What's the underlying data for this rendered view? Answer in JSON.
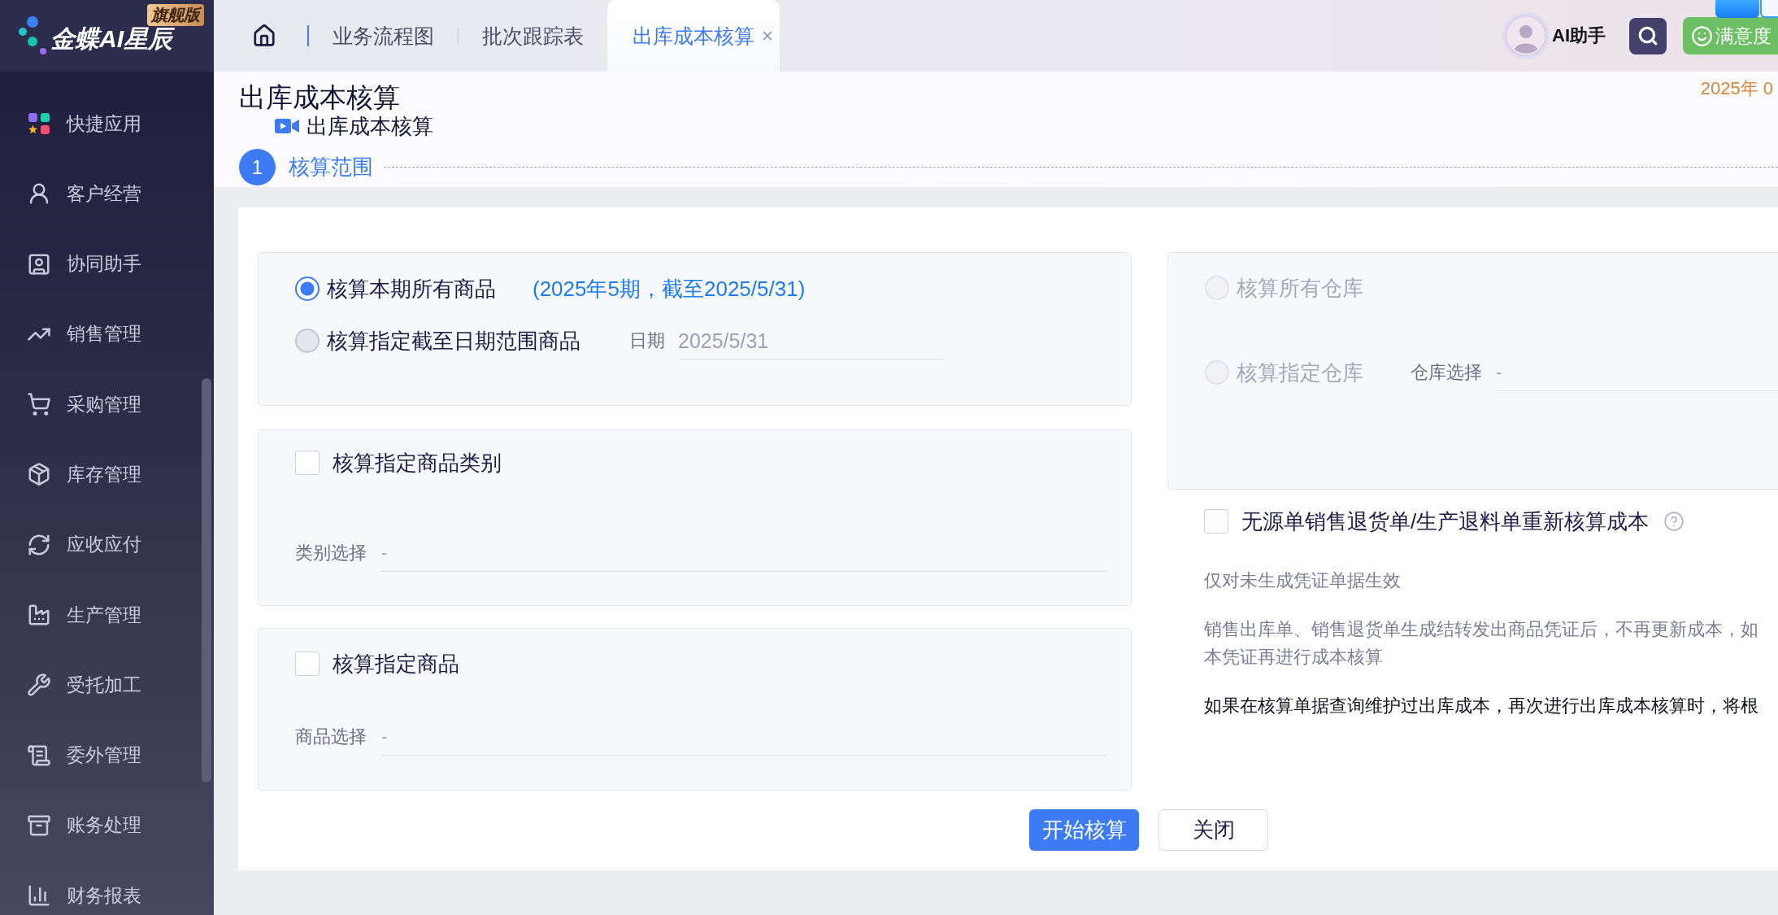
{
  "sidebar": {
    "logo": {
      "text": "金蝶AI星辰",
      "badge": "旗舰版"
    },
    "items": [
      {
        "label": "快捷应用",
        "selected": false
      },
      {
        "label": "客户经营",
        "selected": false
      },
      {
        "label": "协同助手",
        "selected": false
      },
      {
        "label": "销售管理",
        "selected": false
      },
      {
        "label": "采购管理",
        "selected": false
      },
      {
        "label": "库存管理",
        "selected": false
      },
      {
        "label": "应收应付",
        "selected": false
      },
      {
        "label": "生产管理",
        "selected": false
      },
      {
        "label": "受托加工",
        "selected": false
      },
      {
        "label": "委外管理",
        "selected": false
      },
      {
        "label": "账务处理",
        "selected": false
      },
      {
        "label": "财务报表",
        "selected": false
      }
    ]
  },
  "header": {
    "tabs": [
      {
        "label": "业务流程图",
        "selected": false
      },
      {
        "label": "批次跟踪表",
        "selected": false
      },
      {
        "label": "出库成本核算",
        "selected": true
      }
    ],
    "assistant": {
      "label": "AI助手"
    },
    "feedback": {
      "label": "满意度"
    }
  },
  "page": {
    "title": "出库成本核算",
    "date": "2025年 0",
    "subtitle": "出库成本核算",
    "step": {
      "number": "1",
      "label": "核算范围"
    }
  },
  "scope": {
    "period": [
      {
        "label": "核算本期所有商品",
        "selected": true,
        "disabled": false,
        "note": "(2025年5期，截至2025/5/31)"
      },
      {
        "label": "核算指定截至日期范围商品",
        "selected": false,
        "disabled": false,
        "field": {
          "label": "日期",
          "value": "2025/5/31"
        }
      }
    ],
    "category": {
      "label": "核算指定商品类别",
      "checked": false,
      "field": {
        "label": "类别选择",
        "value": "-"
      }
    },
    "product": {
      "label": "核算指定商品",
      "checked": false,
      "field": {
        "label": "商品选择",
        "value": "-"
      }
    },
    "warehouse": [
      {
        "label": "核算所有仓库",
        "selected": false,
        "disabled": true
      },
      {
        "label": "核算指定仓库",
        "selected": false,
        "disabled": true,
        "field": {
          "label": "仓库选择",
          "value": "-"
        }
      }
    ],
    "recalc": {
      "label": "无源单销售退货单/生产退料单重新核算成本",
      "checked": false
    },
    "notes": [
      {
        "kind": "muted",
        "lines": [
          "仅对未生成凭证单据生效"
        ]
      },
      {
        "kind": "muted",
        "lines": [
          "销售出库单、销售退货单生成结转发出商品凭证后，不再更新成本，如",
          "本凭证再进行成本核算"
        ]
      },
      {
        "kind": "plain",
        "lines": [
          "如果在核算单据查询维护过出库成本，再次进行出库成本核算时，将根"
        ]
      }
    ]
  },
  "actions": [
    {
      "label": "开始核算",
      "kind": "primary"
    },
    {
      "label": "关闭",
      "kind": "default"
    }
  ]
}
